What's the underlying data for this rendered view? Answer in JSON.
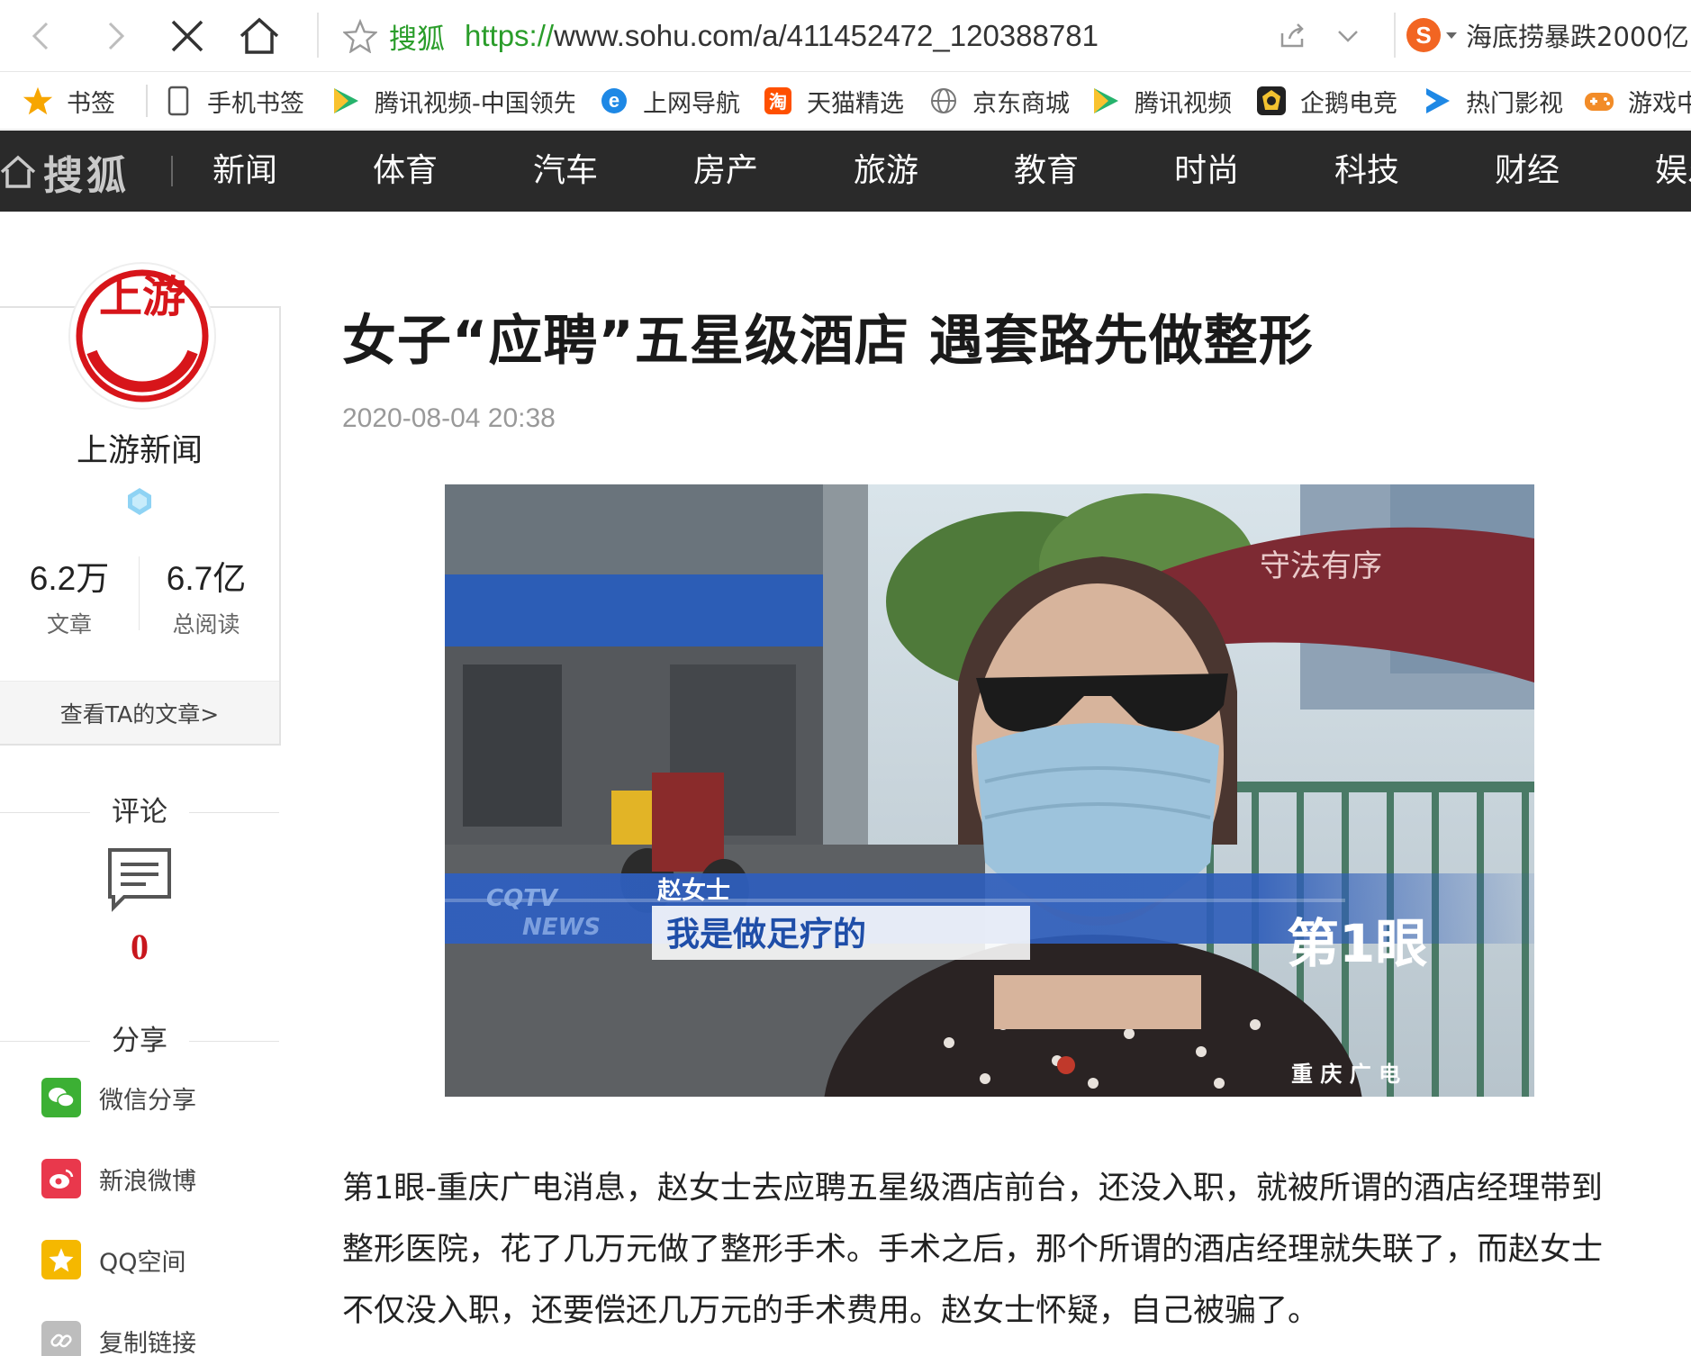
{
  "browser": {
    "site_label": "搜狐",
    "url_protocol": "https://",
    "url_rest": "www.sohu.com/a/411452472_120388781",
    "search_hot": "海底捞暴跌2000亿"
  },
  "bookmarks": [
    {
      "label": "书签",
      "icon": "star-icon"
    },
    {
      "label": "手机书签",
      "icon": "phone-icon"
    },
    {
      "label": "腾讯视频-中国领先",
      "icon": "play-icon"
    },
    {
      "label": "上网导航",
      "icon": "ie-icon"
    },
    {
      "label": "天猫精选",
      "icon": "taobao-icon"
    },
    {
      "label": "京东商城",
      "icon": "globe-icon"
    },
    {
      "label": "腾讯视频",
      "icon": "play-icon"
    },
    {
      "label": "企鹅电竞",
      "icon": "penguin-icon"
    },
    {
      "label": "热门影视",
      "icon": "video-icon"
    },
    {
      "label": "游戏中",
      "icon": "gamepad-icon"
    }
  ],
  "sohu_nav": {
    "logo": "搜狐",
    "items": [
      "新闻",
      "体育",
      "汽车",
      "房产",
      "旅游",
      "教育",
      "时尚",
      "科技",
      "财经",
      "娱乐"
    ]
  },
  "author": {
    "logo_text": "上游",
    "name": "上游新闻",
    "articles_count": "6.2万",
    "articles_label": "文章",
    "reads_count": "6.7亿",
    "reads_label": "总阅读",
    "view_link": "查看TA的文章>"
  },
  "comments": {
    "title": "评论",
    "count": "0"
  },
  "share": {
    "title": "分享",
    "items": [
      {
        "label": "微信分享",
        "color": "#3cb034"
      },
      {
        "label": "新浪微博",
        "color": "#e6162d"
      },
      {
        "label": "QQ空间",
        "color": "#f5b800"
      },
      {
        "label": "复制链接",
        "color": "#bdbdbd"
      }
    ]
  },
  "article": {
    "title": "女子“应聘”五星级酒店 遇套路先做整形",
    "date": "2020-08-04 20:38",
    "image": {
      "umbrella_text": "守法有序",
      "caption_name": "赵女士",
      "caption_quote": "我是做足疗的",
      "news_tag_1": "CQTV",
      "news_tag_2": "NEWS",
      "station_logo": "第1眼",
      "station_sub": "重 庆 广 电"
    },
    "paragraphs": [
      "第1眼-重庆广电消息，赵女士去应聘五星级酒店前台，还没入职，就被所谓的酒店经理带到",
      "整形医院，花了几万元做了整形手术。手术之后，那个所谓的酒店经理就失联了，而赵女士",
      "不仅没入职，还要偿还几万元的手术费用。赵女士怀疑，自己被骗了。"
    ]
  }
}
